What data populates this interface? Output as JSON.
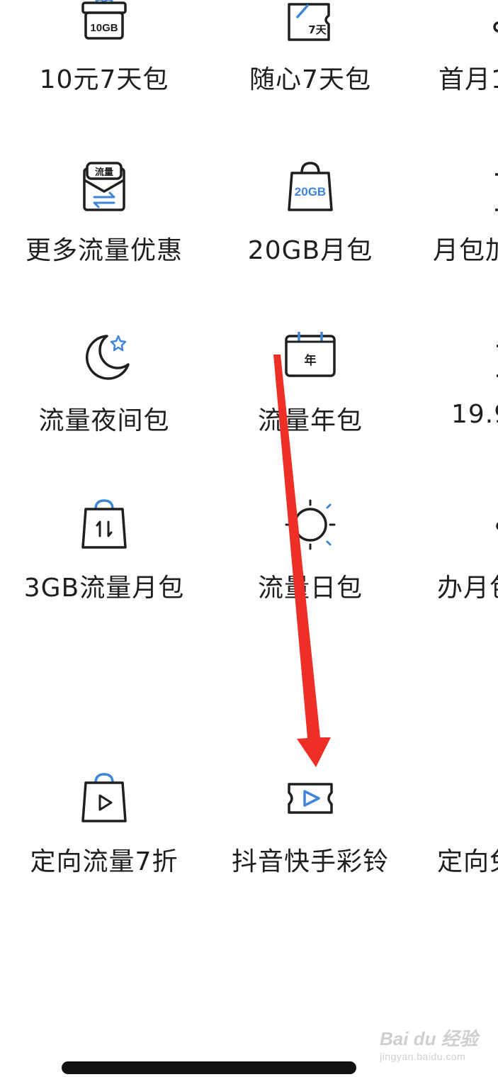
{
  "tiles": [
    {
      "label": "10元7天包",
      "icon": "gift-box-10gb-icon",
      "icon_text": "10GB"
    },
    {
      "label": "随心7天包",
      "icon": "ticket-7day-icon",
      "icon_text": "7天"
    },
    {
      "label": "首月1",
      "icon": "partial-icon"
    },
    {
      "label": "更多流量优惠",
      "icon": "data-envelope-icon",
      "icon_text": "流量"
    },
    {
      "label": "20GB月包",
      "icon": "shopping-bag-20gb-icon",
      "icon_text": "20GB"
    },
    {
      "label": "月包加",
      "icon": "partial-icon"
    },
    {
      "label": "流量夜间包",
      "icon": "moon-star-icon"
    },
    {
      "label": "流量年包",
      "icon": "calendar-year-icon",
      "icon_text": "年"
    },
    {
      "label": "19.9",
      "icon": "partial-icon"
    },
    {
      "label": "3GB流量月包",
      "icon": "shopping-bag-transfer-icon"
    },
    {
      "label": "流量日包",
      "icon": "sun-icon"
    },
    {
      "label": "办月包",
      "icon": "partial-icon"
    },
    {
      "label": "定向流量7折",
      "icon": "shopping-bag-play-icon"
    },
    {
      "label": "抖音快手彩铃",
      "icon": "video-ticket-icon"
    },
    {
      "label": "定向免",
      "icon": "partial-icon"
    }
  ],
  "watermark": {
    "logo": "Bai du 经验",
    "url": "jingyan.baidu.com"
  },
  "colors": {
    "accent": "#3f86d8",
    "arrow": "#ee2f25",
    "text": "#1f1f1f"
  }
}
